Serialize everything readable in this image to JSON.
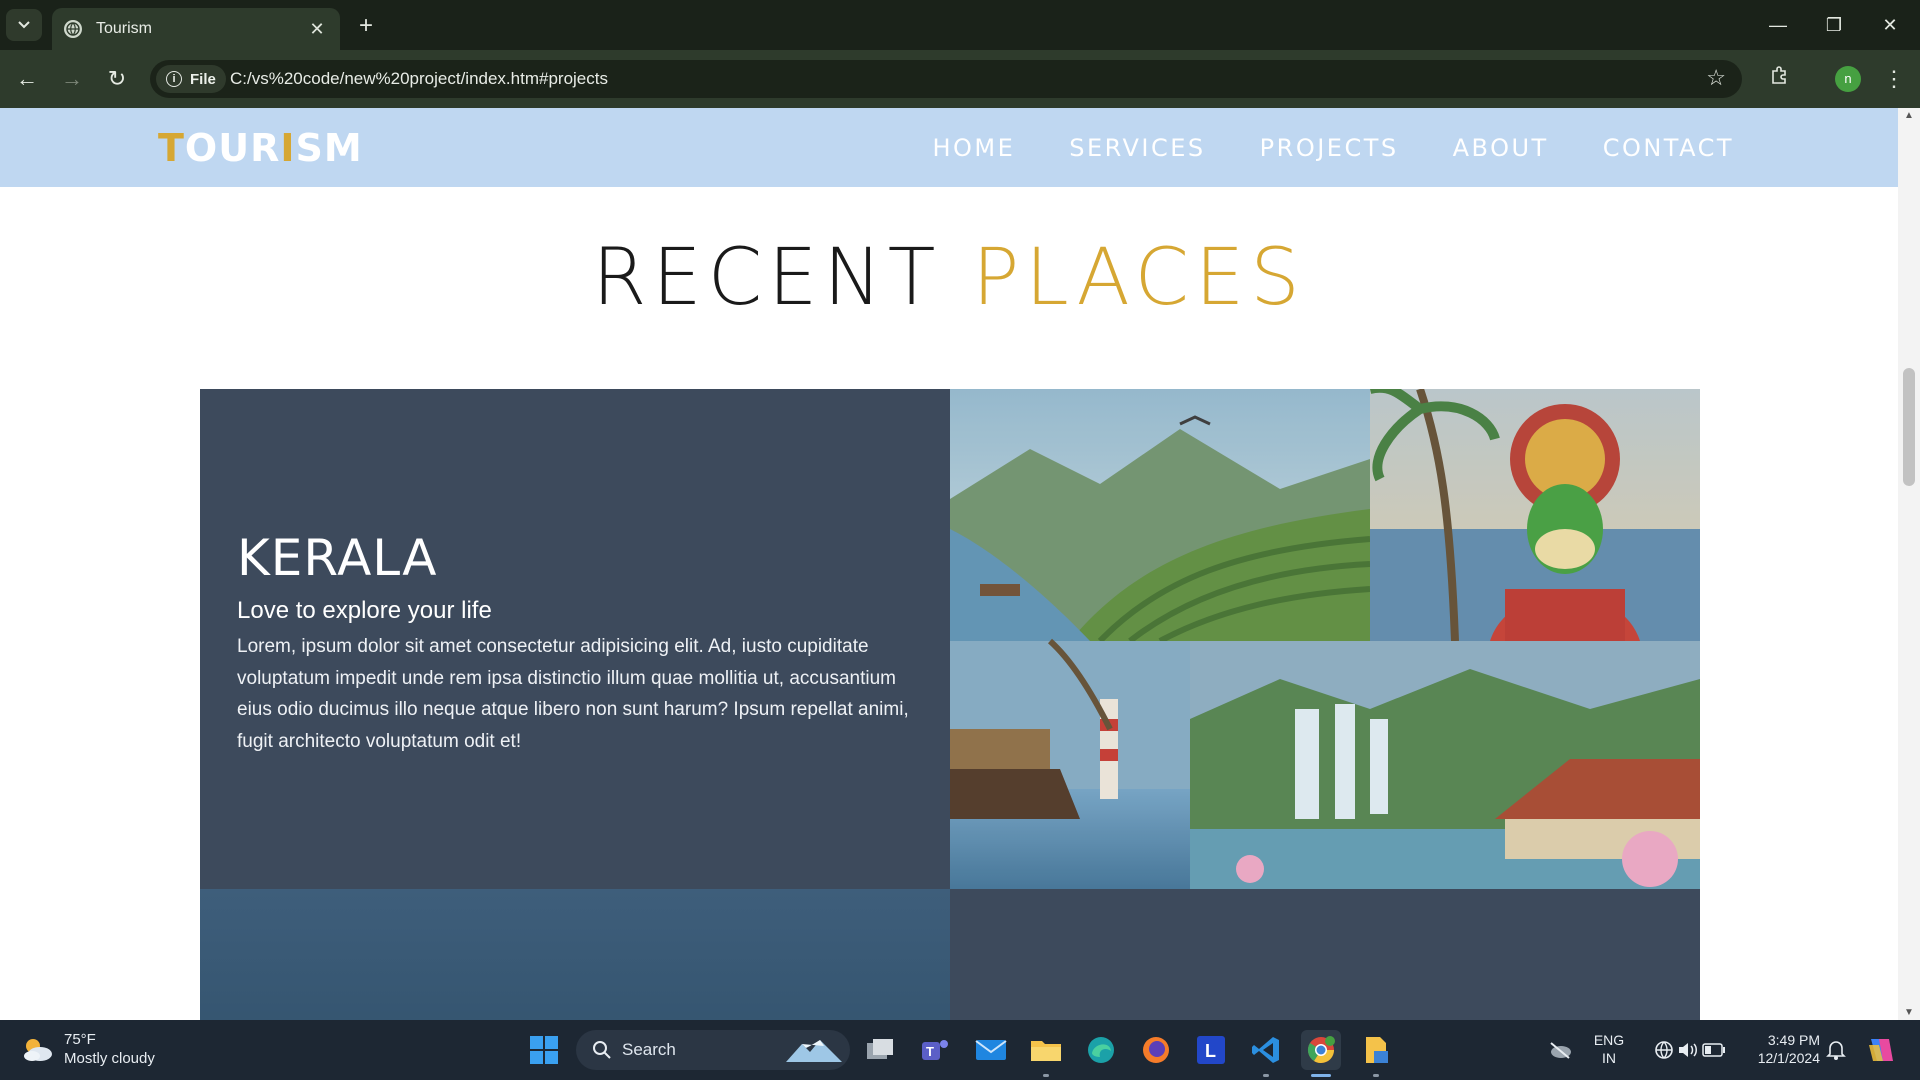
{
  "browser": {
    "tab_title": "Tourism",
    "url_chip": "File",
    "url": "C:/vs%20code/new%20project/index.htm#projects",
    "profile_initial": "n"
  },
  "site": {
    "logo_part1": "T",
    "logo_part2": "OUR",
    "logo_part3": "I",
    "logo_part4": "SM",
    "nav": [
      "HOME",
      "SERVICES",
      "PROJECTS",
      "ABOUT",
      "CONTACT"
    ],
    "section_title_main": "RECENT",
    "section_title_accent": "PLACES",
    "card": {
      "title": "KERALA",
      "subtitle": "Love to explore your life",
      "body": "Lorem, ipsum dolor sit amet consectetur adipisicing elit. Ad, iusto cupiditate voluptatum impedit unde rem ipsa distinctio illum quae mollitia ut, accusantium eius odio ducimus illo neque atque libero non sunt harum? Ipsum repellat animi, fugit architecto voluptatum odit et!"
    }
  },
  "taskbar": {
    "weather_temp": "75°F",
    "weather_desc": "Mostly cloudy",
    "search_label": "Search",
    "lang_top": "ENG",
    "lang_bottom": "IN",
    "time": "3:49 PM",
    "date": "12/1/2024"
  },
  "colors": {
    "accent": "#d6a733",
    "header_bg": "#bfd7f1",
    "card_bg": "#3d4a5c",
    "chrome_bg": "#2e3b2c"
  }
}
